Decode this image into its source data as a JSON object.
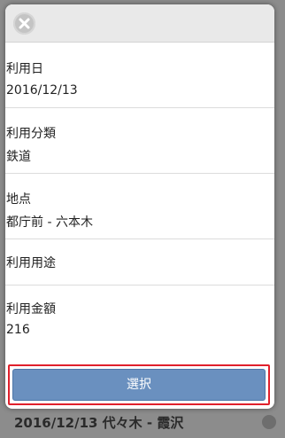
{
  "background": {
    "rows": [
      {
        "text": "2016/12/13 代々木 - 霞沢"
      }
    ]
  },
  "modal": {
    "close_icon": "close-icon",
    "fields": [
      {
        "label": "利用日",
        "value": "2016/12/13"
      },
      {
        "label": "利用分類",
        "value": "鉄道"
      },
      {
        "label": "地点",
        "value": "都庁前 - 六本木"
      },
      {
        "label": "利用用途",
        "value": ""
      },
      {
        "label": "利用金額",
        "value": "216"
      }
    ],
    "select_label": "選択"
  },
  "colors": {
    "button": "#6a90bf",
    "highlight_border": "#e0202c",
    "header": "#e9e9e9"
  }
}
